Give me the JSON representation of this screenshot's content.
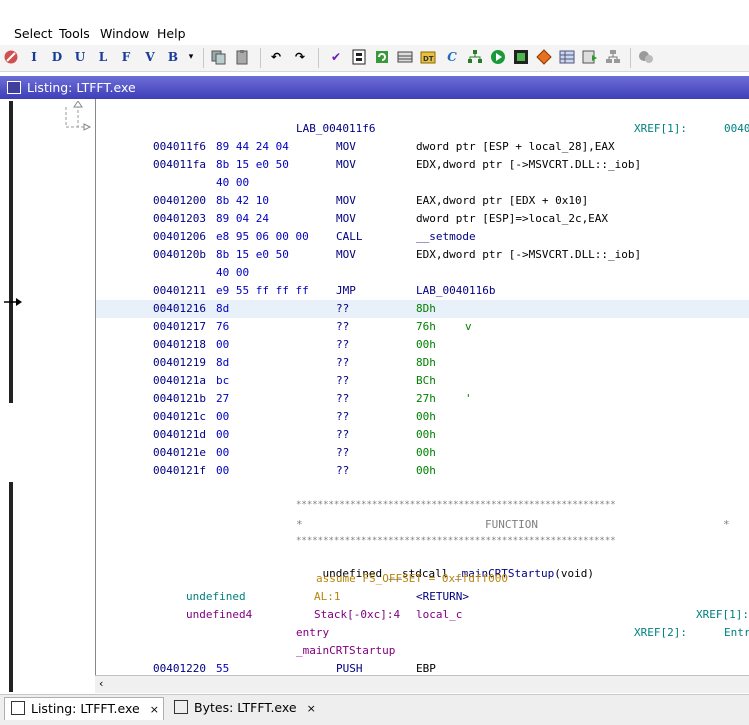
{
  "menu": [
    "Select",
    "Tools",
    "Window",
    "Help"
  ],
  "toolbar_letters": [
    "I",
    "D",
    "U",
    "L",
    "F",
    "V",
    "B"
  ],
  "window": {
    "title": "Listing:  LTFFT.exe"
  },
  "listing": [
    {
      "type": "label",
      "text": "LAB_004011f6",
      "xref": "XREF[1]:",
      "xref_addr": "0040"
    },
    {
      "type": "ins",
      "addr": "004011f6",
      "bytes": "89 44 24 04",
      "mnem": "MOV",
      "oper": "dword ptr [ESP + local_28],EAX"
    },
    {
      "type": "ins",
      "addr": "004011fa",
      "bytes": "8b 15 e0 50",
      "mnem": "MOV",
      "oper": "EDX,dword ptr [->MSVCRT.DLL::_iob]"
    },
    {
      "type": "cont",
      "bytes": "40 00"
    },
    {
      "type": "ins",
      "addr": "00401200",
      "bytes": "8b 42 10",
      "mnem": "MOV",
      "oper": "EAX,dword ptr [EDX + 0x10]"
    },
    {
      "type": "ins",
      "addr": "00401203",
      "bytes": "89 04 24",
      "mnem": "MOV",
      "oper": "dword ptr [ESP]=>local_2c,EAX"
    },
    {
      "type": "ins",
      "addr": "00401206",
      "bytes": "e8 95 06 00 00",
      "mnem": "CALL",
      "oper": "__setmode"
    },
    {
      "type": "ins",
      "addr": "0040120b",
      "bytes": "8b 15 e0 50",
      "mnem": "MOV",
      "oper": "EDX,dword ptr [->MSVCRT.DLL::_iob]"
    },
    {
      "type": "cont",
      "bytes": "40 00"
    },
    {
      "type": "ins",
      "addr": "00401211",
      "bytes": "e9 55 ff ff ff",
      "mnem": "JMP",
      "oper": "LAB_0040116b"
    },
    {
      "type": "data",
      "addr": "00401216",
      "bytes": "8d",
      "mnem": "??",
      "oper": "8Dh",
      "ch": ""
    },
    {
      "type": "data",
      "addr": "00401217",
      "bytes": "76",
      "mnem": "??",
      "oper": "76h",
      "ch": "v"
    },
    {
      "type": "data",
      "addr": "00401218",
      "bytes": "00",
      "mnem": "??",
      "oper": "00h",
      "ch": ""
    },
    {
      "type": "data",
      "addr": "00401219",
      "bytes": "8d",
      "mnem": "??",
      "oper": "8Dh",
      "ch": ""
    },
    {
      "type": "data",
      "addr": "0040121a",
      "bytes": "bc",
      "mnem": "??",
      "oper": "BCh",
      "ch": ""
    },
    {
      "type": "data",
      "addr": "0040121b",
      "bytes": "27",
      "mnem": "??",
      "oper": "27h",
      "ch": "'"
    },
    {
      "type": "data",
      "addr": "0040121c",
      "bytes": "00",
      "mnem": "??",
      "oper": "00h",
      "ch": ""
    },
    {
      "type": "data",
      "addr": "0040121d",
      "bytes": "00",
      "mnem": "??",
      "oper": "00h",
      "ch": ""
    },
    {
      "type": "data",
      "addr": "0040121e",
      "bytes": "00",
      "mnem": "??",
      "oper": "00h",
      "ch": ""
    },
    {
      "type": "data",
      "addr": "0040121f",
      "bytes": "00",
      "mnem": "??",
      "oper": "00h",
      "ch": ""
    }
  ],
  "function": {
    "stars": "***********************************************************",
    "plate_left": "*",
    "plate_title": "FUNCTION",
    "plate_right": "*",
    "signature_ret": "undefined __stdcall ",
    "signature_name": "_mainCRTStartup",
    "signature_args": "(void)",
    "assume": "assume FS_OFFSET = 0xffdff000",
    "vars": [
      {
        "type": "undefined",
        "loc": "AL:1",
        "name": "<RETURN>",
        "xref": ""
      },
      {
        "type": "undefined4",
        "loc": "Stack[-0xc]:4",
        "name": "local_c",
        "xref": "XREF[1]:"
      }
    ],
    "entry": "entry",
    "entry_xref": "XREF[2]:",
    "entry_xref_val": "Entr",
    "label": "_mainCRTStartup",
    "first_ins": {
      "addr": "00401220",
      "bytes": "55",
      "mnem": "PUSH",
      "oper": "EBP"
    }
  },
  "tabs": [
    {
      "label": "Listing:  LTFFT.exe",
      "close": "×"
    },
    {
      "label": "Bytes: LTFFT.exe",
      "close": "×"
    }
  ]
}
